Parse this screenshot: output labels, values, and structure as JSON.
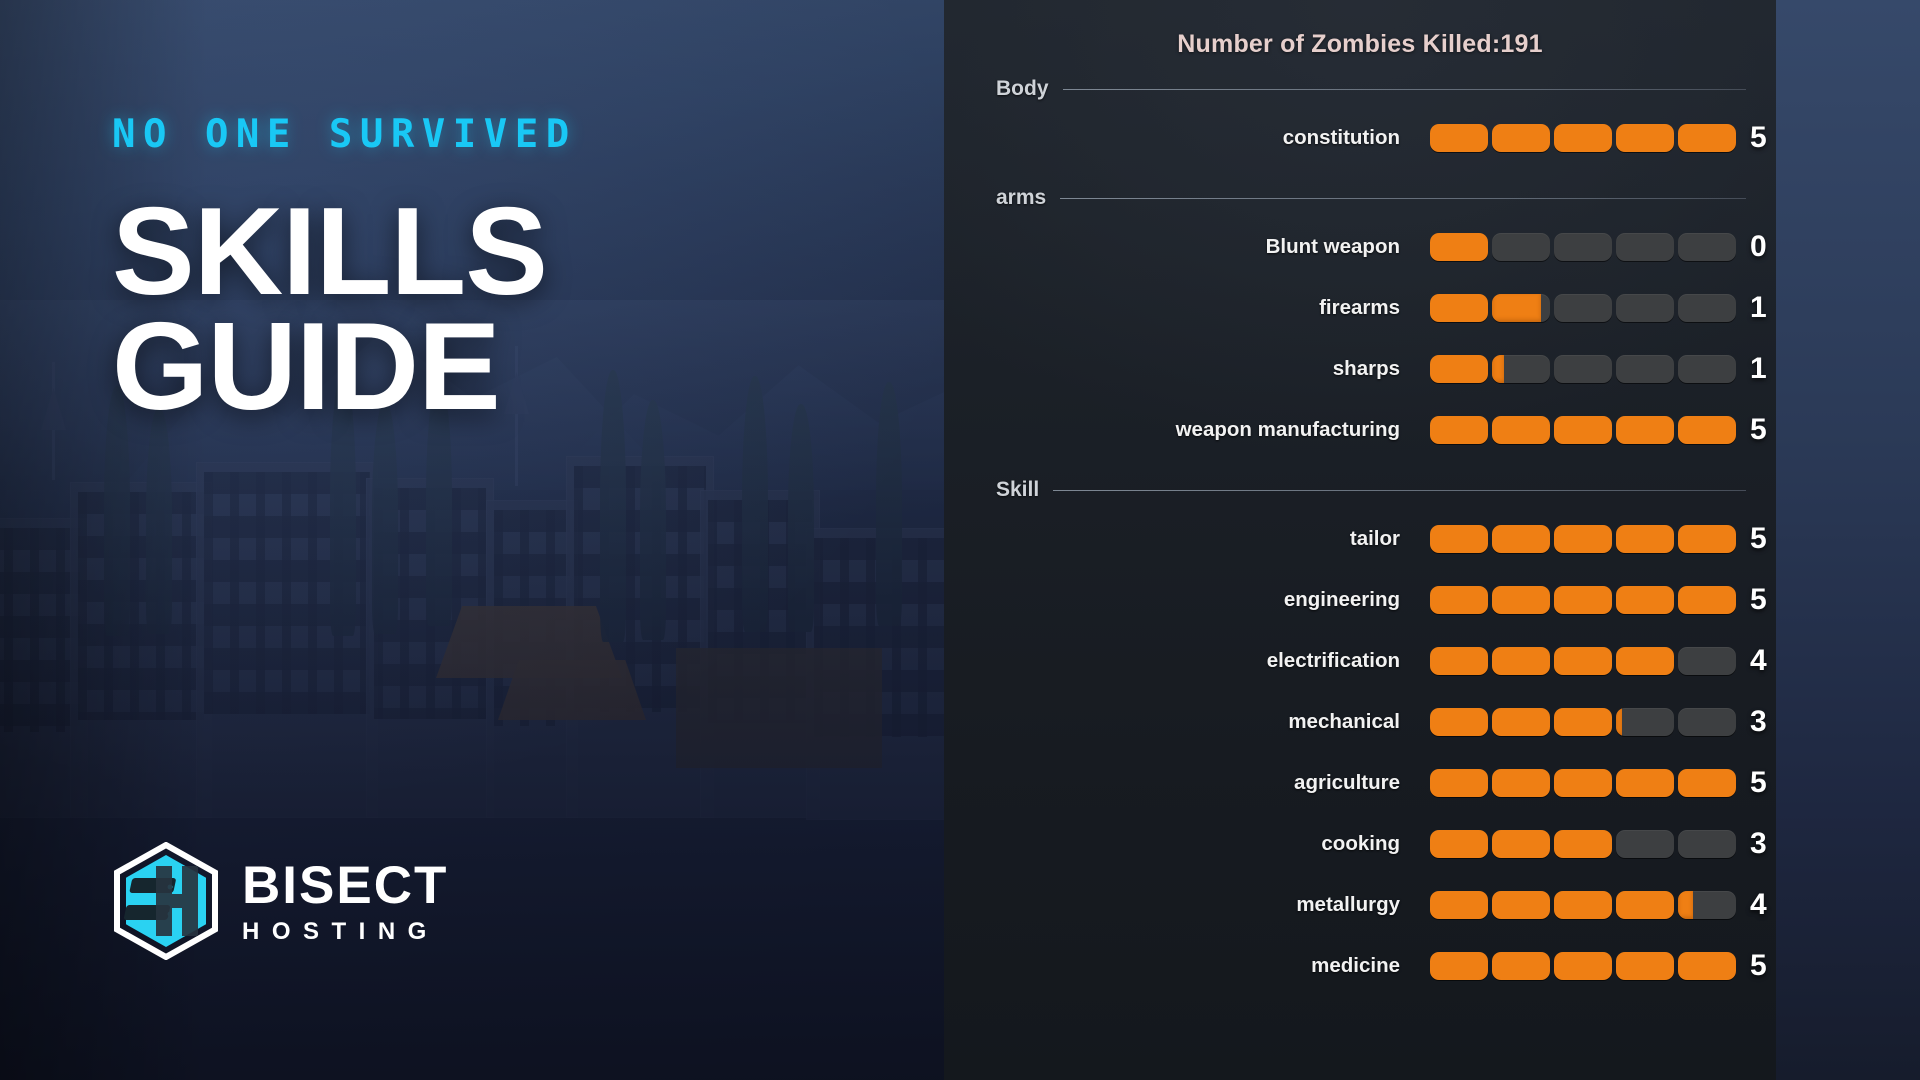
{
  "hero": {
    "kicker": "NO ONE SURVIVED",
    "title_line1": "SKILLS",
    "title_line2": "GUIDE",
    "logo": {
      "monogram": "BH",
      "brand_primary": "BISECT",
      "brand_secondary": "HOSTING",
      "accent_color": "#2ad2f2"
    }
  },
  "panel": {
    "title": "Number of Zombies Killed:191",
    "zombies_killed": 191,
    "max_level": 5,
    "colors": {
      "filled": "#ef7f14",
      "empty": "#3d3f41",
      "title": "#e6cfcc"
    },
    "sections": [
      {
        "label": "Body",
        "skills": [
          {
            "name": "constitution",
            "value": 5,
            "progress": 5.0
          }
        ]
      },
      {
        "label": "arms",
        "skills": [
          {
            "name": "Blunt weapon",
            "value": 0,
            "progress": 1.0
          },
          {
            "name": "firearms",
            "value": 1,
            "progress": 1.85
          },
          {
            "name": "sharps",
            "value": 1,
            "progress": 1.2
          },
          {
            "name": "weapon manufacturing",
            "value": 5,
            "progress": 5.0
          }
        ]
      },
      {
        "label": "Skill",
        "skills": [
          {
            "name": "tailor",
            "value": 5,
            "progress": 5.0
          },
          {
            "name": "engineering",
            "value": 5,
            "progress": 5.0
          },
          {
            "name": "electrification",
            "value": 4,
            "progress": 4.0
          },
          {
            "name": "mechanical",
            "value": 3,
            "progress": 3.1
          },
          {
            "name": "agriculture",
            "value": 5,
            "progress": 5.0
          },
          {
            "name": "cooking",
            "value": 3,
            "progress": 3.0
          },
          {
            "name": "metallurgy",
            "value": 4,
            "progress": 4.25
          },
          {
            "name": "medicine",
            "value": 5,
            "progress": 5.0
          }
        ]
      }
    ]
  }
}
